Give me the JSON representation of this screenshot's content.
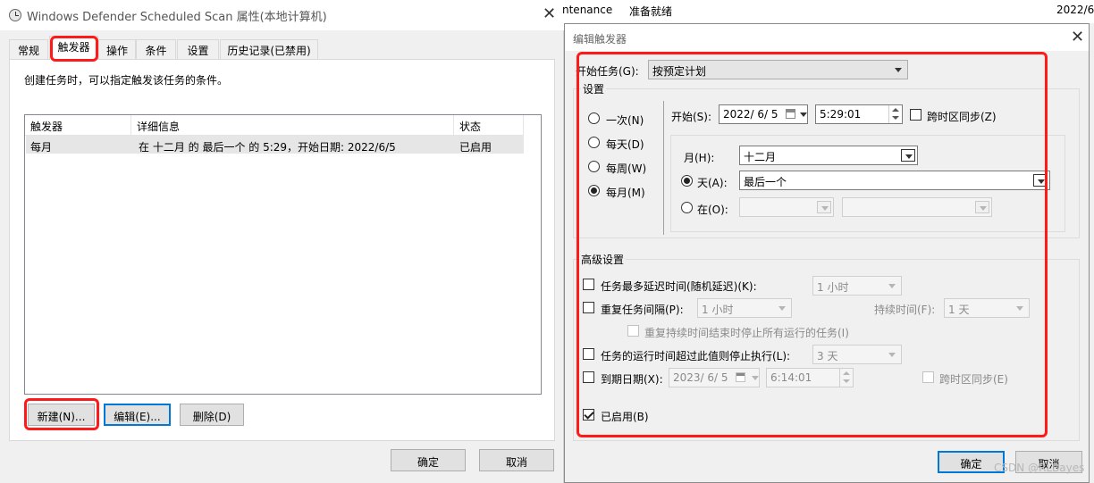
{
  "background_window": {
    "col1": "ntenance",
    "col2": "准备就绪",
    "col3": "2022/6/"
  },
  "left_dialog": {
    "title": "Windows Defender Scheduled Scan 属性(本地计算机)",
    "tabs": [
      {
        "label": "常规"
      },
      {
        "label": "触发器"
      },
      {
        "label": "操作"
      },
      {
        "label": "条件"
      },
      {
        "label": "设置"
      },
      {
        "label": "历史记录(已禁用)"
      }
    ],
    "description": "创建任务时，可以指定触发该任务的条件。",
    "table": {
      "headers": [
        "触发器",
        "详细信息",
        "状态"
      ],
      "rows": [
        {
          "trigger": "每月",
          "details": "在 十二月 的 最后一个 的 5:29，开始日期: 2022/6/5",
          "status": "已启用"
        }
      ]
    },
    "buttons": {
      "new": "新建(N)...",
      "edit": "编辑(E)...",
      "delete": "删除(D)",
      "ok": "确定",
      "cancel": "取消"
    }
  },
  "right_dialog": {
    "title": "编辑触发器",
    "begin_task_label": "开始任务(G):",
    "begin_task_value": "按预定计划",
    "settings_label": "设置",
    "schedule_options": [
      {
        "label": "一次(N)",
        "selected": false
      },
      {
        "label": "每天(D)",
        "selected": false
      },
      {
        "label": "每周(W)",
        "selected": false
      },
      {
        "label": "每月(M)",
        "selected": true
      }
    ],
    "start": {
      "label": "开始(S):",
      "date": "2022/ 6/ 5",
      "time": "5:29:01",
      "sync_label": "跨时区同步(Z)"
    },
    "month": {
      "label": "月(H):",
      "value": "十二月"
    },
    "day": {
      "label": "天(A):",
      "value": "最后一个",
      "selected": true
    },
    "on": {
      "label": "在(O):",
      "selected": false
    },
    "advanced": {
      "label": "高级设置",
      "random_delay": {
        "label": "任务最多延迟时间(随机延迟)(K):",
        "value": "1 小时",
        "checked": false
      },
      "repeat": {
        "label": "重复任务间隔(P):",
        "value": "1 小时",
        "checked": false
      },
      "duration": {
        "label": "持续时间(F):",
        "value": "1 天"
      },
      "stop_running": {
        "label": "重复持续时间结束时停止所有运行的任务(I)"
      },
      "stop_if_longer": {
        "label": "任务的运行时间超过此值则停止执行(L):",
        "value": "3 天",
        "checked": false
      },
      "expire": {
        "label": "到期日期(X):",
        "date": "2023/ 6/ 5",
        "time": "6:14:01",
        "checked": false,
        "sync_label": "跨时区同步(E)"
      },
      "enabled": {
        "label": "已启用(B)",
        "checked": true
      }
    },
    "buttons": {
      "ok": "确定",
      "cancel": "取消"
    }
  },
  "watermark": "CSDN @RLBayes",
  "colors": {
    "highlight_red": "#ff1a1a",
    "focus_blue": "#0078d7",
    "dialog_bg": "#f0f0f0"
  }
}
